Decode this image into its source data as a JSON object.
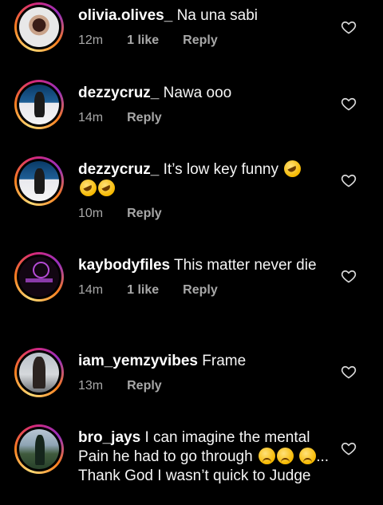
{
  "comments": [
    {
      "user": "olivia.olives_",
      "text": "Na una sabi",
      "time": "12m",
      "likes": "1 like",
      "reply": "Reply",
      "avatar": "olivia-avatar"
    },
    {
      "user": "dezzycruz_",
      "text": "Nawa ooo",
      "time": "14m",
      "likes": "",
      "reply": "Reply",
      "avatar": "dezzy-avatar"
    },
    {
      "user": "dezzycruz_",
      "text": "It’s low key funny",
      "time": "10m",
      "likes": "",
      "reply": "Reply",
      "avatar": "dezzy-avatar"
    },
    {
      "user": "kaybodyfiles",
      "text": "This matter never die",
      "time": "14m",
      "likes": "1 like",
      "reply": "Reply",
      "avatar": "kaybody-avatar"
    },
    {
      "user": "iam_yemzyvibes",
      "text": "Frame",
      "time": "13m",
      "likes": "",
      "reply": "Reply",
      "avatar": "yemzy-avatar"
    },
    {
      "user": "bro_jays",
      "text": "I can imagine the mental Pain he had to go through",
      "text_tail": "... Thank God I wasn’t quick to Judge",
      "time": "",
      "likes": "",
      "reply": "",
      "avatar": "bro-avatar"
    }
  ],
  "emojis": {
    "rofl": "rolling-on-floor-laughing-emoji",
    "sad": "disappointed-relieved-emoji"
  },
  "colors": {
    "background": "#000000",
    "text": "#f5f5f5",
    "meta": "#a8a8a8",
    "ring_start": "#feda75",
    "ring_end": "#962fbf"
  }
}
